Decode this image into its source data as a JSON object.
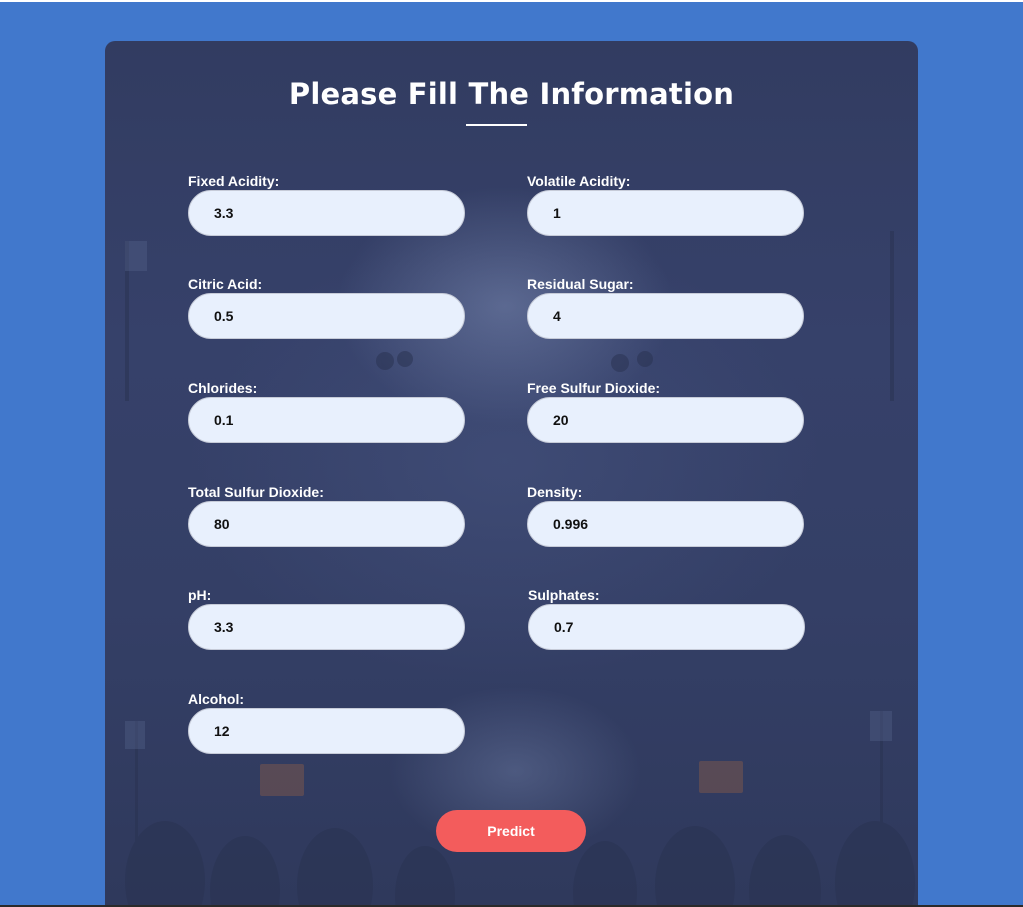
{
  "form": {
    "title": "Please Fill The Information",
    "fields": [
      {
        "label": "Fixed Acidity:",
        "value": "3.3"
      },
      {
        "label": "Volatile Acidity:",
        "value": "1"
      },
      {
        "label": "Citric Acid:",
        "value": "0.5"
      },
      {
        "label": "Residual Sugar:",
        "value": "4"
      },
      {
        "label": "Chlorides:",
        "value": "0.1"
      },
      {
        "label": "Free Sulfur Dioxide:",
        "value": "20"
      },
      {
        "label": "Total Sulfur Dioxide:",
        "value": "80"
      },
      {
        "label": "Density:",
        "value": "0.996"
      },
      {
        "label": "pH:",
        "value": "3.3"
      },
      {
        "label": "Sulphates:",
        "value": "0.7"
      },
      {
        "label": "Alcohol:",
        "value": "12"
      }
    ],
    "submit_label": "Predict"
  },
  "colors": {
    "page_background": "#4178cc",
    "card_background": "#343f66",
    "input_background": "#e8f0fd",
    "button_color": "#f35c5c",
    "text_light": "#ffffff"
  }
}
